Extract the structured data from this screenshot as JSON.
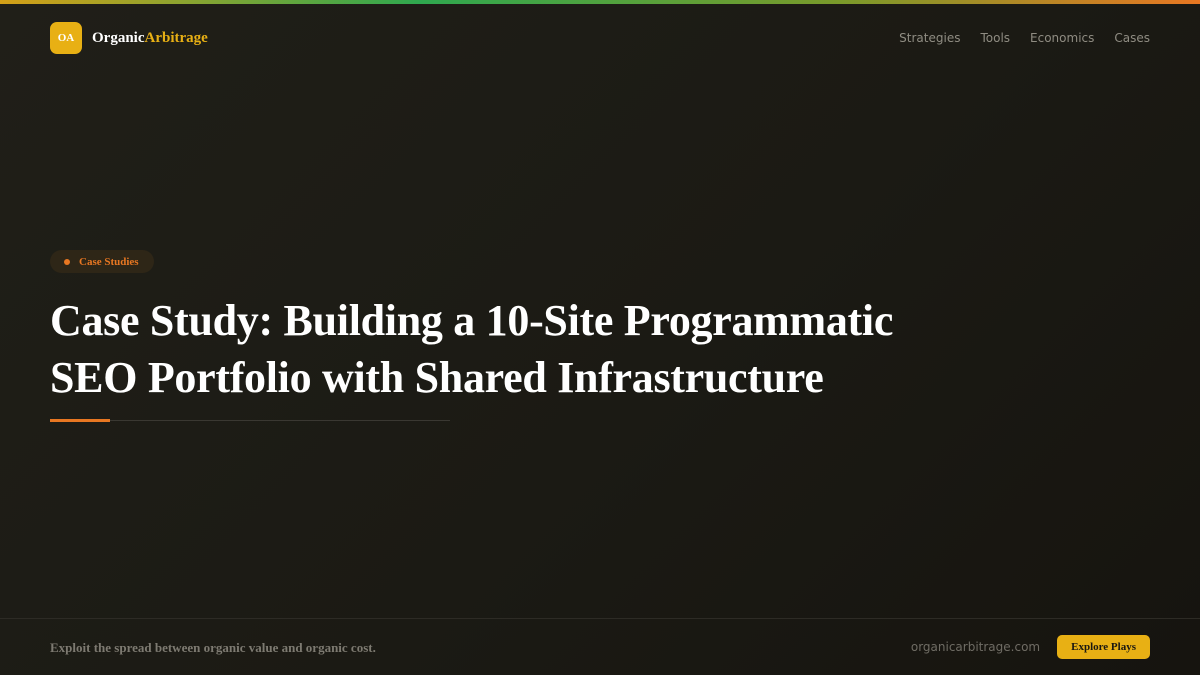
{
  "brand": {
    "logo_initials": "OA",
    "name_part1": "Organic",
    "name_part2": "Arbitrage"
  },
  "nav": {
    "items": [
      "Strategies",
      "Tools",
      "Economics",
      "Cases"
    ]
  },
  "hero": {
    "category_badge": "Case Studies",
    "title_line1": "Case Study: Building a 10-Site Programmatic",
    "title_line2": "SEO Portfolio with Shared Infrastructure"
  },
  "footer": {
    "tagline": "Exploit the spread between organic value and organic cost.",
    "domain": "organicarbitrage.com",
    "cta_label": "Explore Plays"
  },
  "colors": {
    "accent_gold": "#e8b014",
    "accent_orange": "#e87722",
    "accent_green": "#2fa84f",
    "background": "#1d1c16"
  }
}
